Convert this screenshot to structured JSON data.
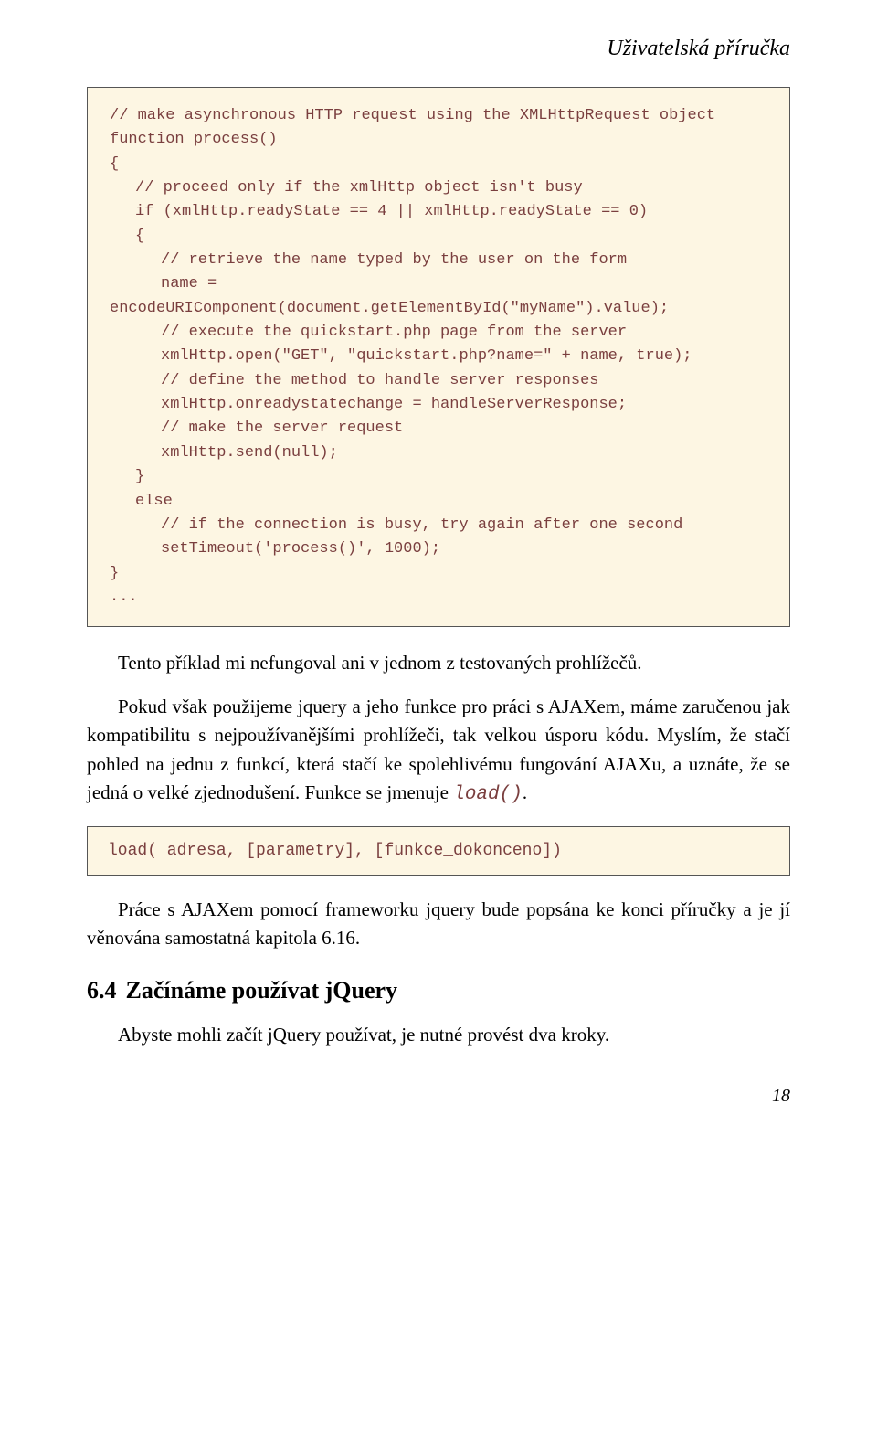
{
  "header": "Uživatelská příručka",
  "code1": {
    "l1": "// make asynchronous HTTP request using the XMLHttpRequest object",
    "l2": "function process()",
    "l3": "{",
    "l4": "// proceed only if the xmlHttp object isn't busy",
    "l5": "if (xmlHttp.readyState == 4 || xmlHttp.readyState == 0)",
    "l6": "{",
    "l7": "// retrieve the name typed by the user on the form",
    "l8": "name =",
    "l8b": "encodeURIComponent(document.getElementById(\"myName\").value);",
    "l9": "// execute the quickstart.php page from the server",
    "l10": "xmlHttp.open(\"GET\", \"quickstart.php?name=\" + name, true);",
    "l11": "// define the method to handle server responses",
    "l12": "xmlHttp.onreadystatechange = handleServerResponse;",
    "l13": "// make the server request",
    "l14": "xmlHttp.send(null);",
    "l15": "}",
    "l16": "else",
    "l17": "// if the connection is busy, try again after one second",
    "l18": "setTimeout('process()', 1000);",
    "l19": "}",
    "l20": "..."
  },
  "para1": "Tento příklad mi nefungoval ani v jednom z testovaných prohlížečů.",
  "para2_a": "Pokud však použijeme jquery a jeho funkce pro práci s AJAXem, máme zaručenou jak kompatibilitu s nejpoužívanějšími prohlížeči, tak velkou úsporu kódu. Myslím, že stačí pohled na jednu z funkcí, která stačí ke spolehlivému fungování AJAXu, a uznáte, že se jedná o velké zjednodušení. Funkce se jmenuje ",
  "para2_code": "load()",
  "para2_b": ".",
  "code2": "load( adresa, [parametry], [funkce_dokonceno])",
  "para3": "Práce s AJAXem pomocí frameworku jquery bude popsána ke konci příručky a je jí věnována samostatná kapitola 6.16.",
  "section_num": "6.4",
  "section_title": "Začínáme používat jQuery",
  "para4": "Abyste mohli začít jQuery používat, je nutné provést dva kroky.",
  "page_number": "18"
}
